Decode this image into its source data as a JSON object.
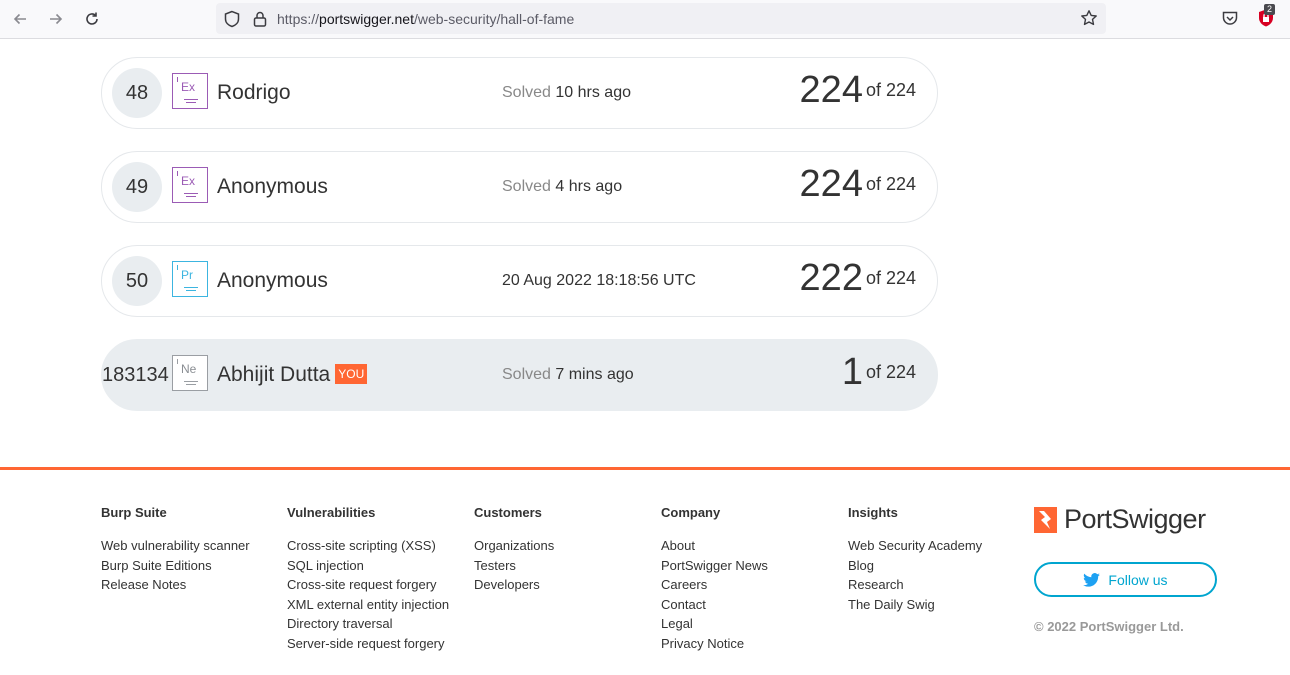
{
  "browser": {
    "url_prefix": "https://",
    "url_domain": "portswigger.net",
    "url_path": "/web-security/hall-of-fame",
    "extension_badge": "2"
  },
  "rows": [
    {
      "rank": "48",
      "badge": "Ex",
      "badge_level": "expert",
      "name": "Rodrigo",
      "solved_prefix": "Solved",
      "solved_time": "10 hrs ago",
      "score": "224",
      "total": "of 224"
    },
    {
      "rank": "49",
      "badge": "Ex",
      "badge_level": "expert",
      "name": "Anonymous",
      "solved_prefix": "Solved",
      "solved_time": "4 hrs ago",
      "score": "224",
      "total": "of 224"
    },
    {
      "rank": "50",
      "badge": "Pr",
      "badge_level": "practitioner",
      "name": "Anonymous",
      "solved_prefix": "",
      "solved_time": "20 Aug 2022 18:18:56 UTC",
      "score": "222",
      "total": "of 224"
    },
    {
      "rank": "183134",
      "badge": "Ne",
      "badge_level": "newcomer",
      "name": "Abhijit Dutta",
      "you_tag": "YOU",
      "solved_prefix": "Solved",
      "solved_time": "7 mins ago",
      "score": "1",
      "total": "of 224"
    }
  ],
  "footer": {
    "columns": [
      {
        "title": "Burp Suite",
        "links": [
          "Web vulnerability scanner",
          "Burp Suite Editions",
          "Release Notes"
        ]
      },
      {
        "title": "Vulnerabilities",
        "links": [
          "Cross-site scripting (XSS)",
          "SQL injection",
          "Cross-site request forgery",
          "XML external entity injection",
          "Directory traversal",
          "Server-side request forgery"
        ]
      },
      {
        "title": "Customers",
        "links": [
          "Organizations",
          "Testers",
          "Developers"
        ]
      },
      {
        "title": "Company",
        "links": [
          "About",
          "PortSwigger News",
          "Careers",
          "Contact",
          "Legal",
          "Privacy Notice"
        ]
      },
      {
        "title": "Insights",
        "links": [
          "Web Security Academy",
          "Blog",
          "Research",
          "The Daily Swig"
        ]
      }
    ],
    "brand": "PortSwigger",
    "follow_label": "Follow us",
    "copyright": "© 2022 PortSwigger Ltd."
  },
  "colors": {
    "accent": "#ff6633",
    "twitter": "#00a5cf",
    "expert": "#9b5bb5",
    "practitioner": "#3cb5e0",
    "newcomer": "#9a9ea3"
  }
}
